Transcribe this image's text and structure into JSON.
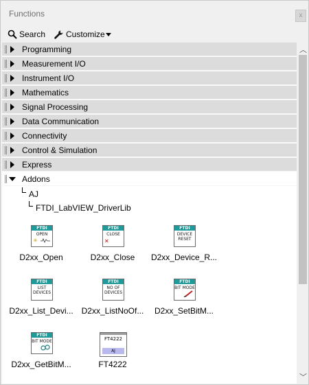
{
  "window": {
    "title": "Functions",
    "close_label": "x"
  },
  "toolbar": {
    "search_label": "Search",
    "customize_label": "Customize"
  },
  "categories": [
    {
      "label": "Programming"
    },
    {
      "label": "Measurement I/O"
    },
    {
      "label": "Instrument I/O"
    },
    {
      "label": "Mathematics"
    },
    {
      "label": "Signal Processing"
    },
    {
      "label": "Data Communication"
    },
    {
      "label": "Connectivity"
    },
    {
      "label": "Control & Simulation"
    },
    {
      "label": "Express"
    },
    {
      "label": "Addons"
    }
  ],
  "tree": {
    "level1": "AJ",
    "level2": "FTDI_LabVIEW_DriverLib"
  },
  "functions": [
    {
      "name": "D2xx_Open",
      "icon_brand": "FTDI",
      "icon_text": "OPEN",
      "icon": "ftdi-open-icon"
    },
    {
      "name": "D2xx_Close",
      "icon_brand": "FTDI",
      "icon_text": "CLOSE",
      "icon": "ftdi-close-icon"
    },
    {
      "name": "D2xx_Device_R...",
      "icon_brand": "FTDI",
      "icon_text": "DEVICE RESET",
      "icon": "ftdi-device-reset-icon"
    },
    {
      "name": "D2xx_List_Devi...",
      "icon_brand": "FTDI",
      "icon_text": "LIST DEVICES",
      "icon": "ftdi-list-devices-icon"
    },
    {
      "name": "D2xx_ListNoOf...",
      "icon_brand": "FTDI",
      "icon_text": "NO OF DEVICES",
      "icon": "ftdi-no-of-devices-icon"
    },
    {
      "name": "D2xx_SetBitM...",
      "icon_brand": "FTDI",
      "icon_text": "BIT MODE",
      "icon": "ftdi-set-bit-mode-icon"
    },
    {
      "name": "D2xx_GetBitM...",
      "icon_brand": "FTDI",
      "icon_text": "BIT MODE",
      "icon": "ftdi-get-bit-mode-icon"
    },
    {
      "name": "FT4222",
      "icon_brand": "FT4222",
      "icon_text": "AJ",
      "icon": "ft4222-folder-icon"
    }
  ],
  "colors": {
    "ftdi_teal": "#1f9a9a",
    "category_bg": "#dcdcdc",
    "window_bg": "#f0f0f0"
  }
}
